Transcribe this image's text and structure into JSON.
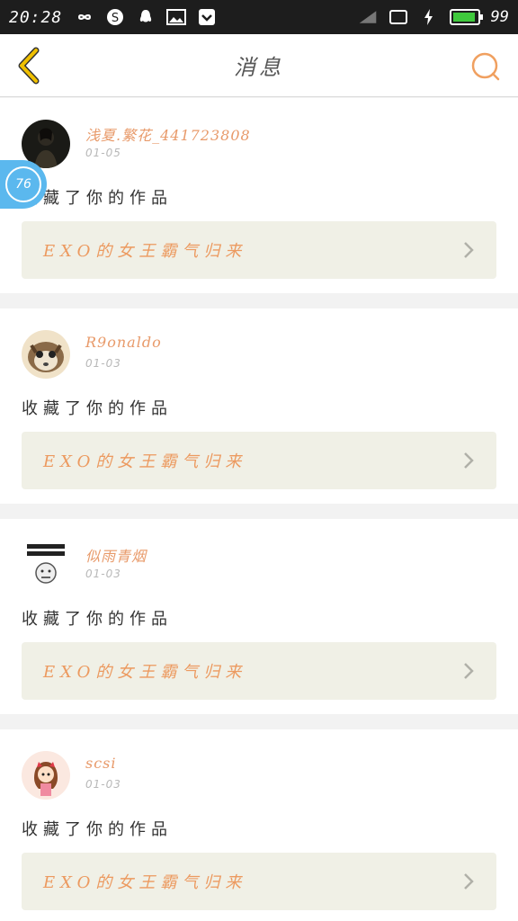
{
  "status_bar": {
    "time": "20:28",
    "battery_text": "99",
    "battery_level": 0.95,
    "battery_color": "#3fc93c"
  },
  "nav": {
    "title": "消息",
    "back_icon": "chevron-left-icon",
    "search_icon": "search-icon",
    "accent": "#f0c000",
    "search_color": "#f0a060"
  },
  "floating_badge": {
    "value": "76"
  },
  "messages": [
    {
      "name": "浅夏.繁花_441723808",
      "date": "01-05",
      "action": "收藏了你的作品",
      "work_title": "EXO的女王霸气归来"
    },
    {
      "name": "R9onaldo",
      "date": "01-03",
      "action": "收藏了你的作品",
      "work_title": "EXO的女王霸气归来"
    },
    {
      "name": "似雨青烟",
      "date": "01-03",
      "action": "收藏了你的作品",
      "work_title": "EXO的女王霸气归来"
    },
    {
      "name": "scsi",
      "date": "01-03",
      "action": "收藏了你的作品",
      "work_title": "EXO的女王霸气归来"
    }
  ],
  "colors": {
    "name_color": "#e89a6a",
    "work_bg": "#f0f0e6",
    "badge_bg": "#5bb8ee"
  }
}
